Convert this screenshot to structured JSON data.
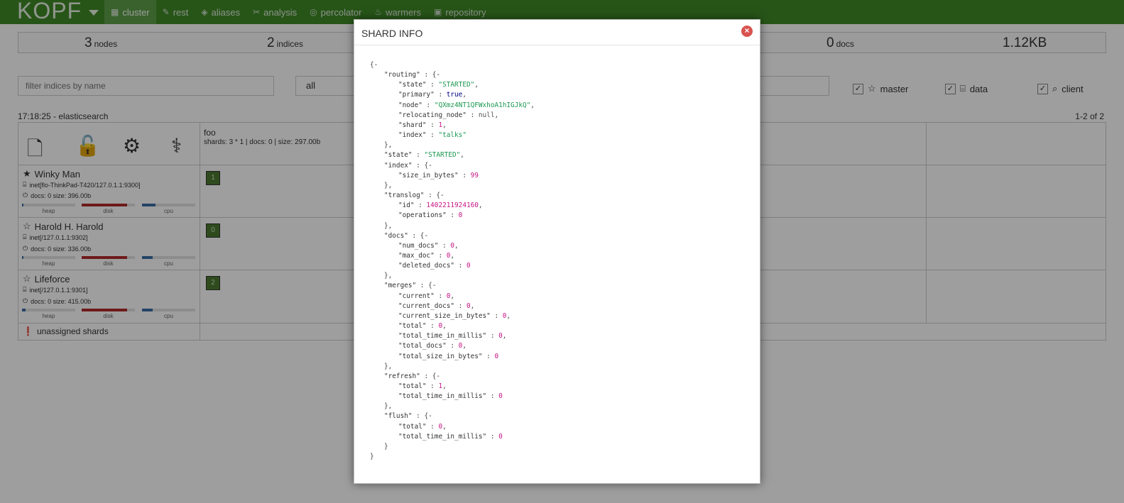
{
  "brand": "KOPF",
  "nav": [
    {
      "label": "cluster",
      "icon": "cluster-icon",
      "active": true
    },
    {
      "label": "rest",
      "icon": "edit-icon"
    },
    {
      "label": "aliases",
      "icon": "tags-icon"
    },
    {
      "label": "analysis",
      "icon": "analysis-icon"
    },
    {
      "label": "percolator",
      "icon": "percolator-icon"
    },
    {
      "label": "warmers",
      "icon": "fire-icon"
    },
    {
      "label": "repository",
      "icon": "briefcase-icon"
    }
  ],
  "stats": {
    "nodes_num": "3",
    "nodes_label": "nodes",
    "indices_num": "2",
    "indices_label": "indices",
    "docs_num": "0",
    "docs_label": "docs",
    "size": "1.12KB"
  },
  "filters": {
    "index_placeholder": "filter indices by name",
    "select_value": "all",
    "master_label": "master",
    "data_label": "data",
    "client_label": "client"
  },
  "cluster_name": "17:18:25 - elasticsearch",
  "pager": "1-2 of 2",
  "index": {
    "name": "foo",
    "info": "shards: 3 * 1 | docs: 0 | size: 297.00b"
  },
  "nodes": [
    {
      "name": "Winky Man",
      "address": "inet[flo-ThinkPad-T420/127.0.1.1:9300]",
      "docs": "docs: 0 size: 396.00b",
      "heap": 0.02,
      "disk": 0.85,
      "cpu": 0.25,
      "shard": "1",
      "master": true
    },
    {
      "name": "Harold H. Harold",
      "address": "inet[/127.0.1.1:9302]",
      "docs": "docs: 0 size: 336.00b",
      "heap": 0.02,
      "disk": 0.85,
      "cpu": 0.2,
      "shard": "0",
      "master": false
    },
    {
      "name": "Lifeforce",
      "address": "inet[/127.0.1.1:9301]",
      "docs": "docs: 0 size: 415.00b",
      "heap": 0.06,
      "disk": 0.85,
      "cpu": 0.2,
      "shard": "2",
      "master": false
    }
  ],
  "bar_labels": {
    "heap": "heap",
    "disk": "disk",
    "cpu": "cpu"
  },
  "unassigned_label": "unassigned shards",
  "modal": {
    "title": "SHARD INFO",
    "lines": [
      [
        [
          0,
          "{"
        ],
        [
          2,
          "-"
        ]
      ],
      [
        [
          1,
          "\"routing\""
        ],
        [
          0,
          " : {"
        ],
        [
          2,
          "-"
        ]
      ],
      [
        [
          1,
          "\"state\""
        ],
        [
          0,
          " : "
        ],
        [
          3,
          "\"STARTED\""
        ],
        [
          0,
          ","
        ]
      ],
      [
        [
          1,
          "\"primary\""
        ],
        [
          0,
          " : "
        ],
        [
          5,
          "true"
        ],
        [
          0,
          ","
        ]
      ],
      [
        [
          1,
          "\"node\""
        ],
        [
          0,
          " : "
        ],
        [
          3,
          "\"QXmz4NT1QFWxhoA1hIGJkQ\""
        ],
        [
          0,
          ","
        ]
      ],
      [
        [
          1,
          "\"relocating_node\""
        ],
        [
          0,
          " : "
        ],
        [
          6,
          "null"
        ],
        [
          0,
          ","
        ]
      ],
      [
        [
          1,
          "\"shard\""
        ],
        [
          0,
          " : "
        ],
        [
          4,
          "1"
        ],
        [
          0,
          ","
        ]
      ],
      [
        [
          1,
          "\"index\""
        ],
        [
          0,
          " : "
        ],
        [
          3,
          "\"talks\""
        ]
      ],
      [
        [
          0,
          "},"
        ]
      ],
      [
        [
          1,
          "\"state\""
        ],
        [
          0,
          " : "
        ],
        [
          3,
          "\"STARTED\""
        ],
        [
          0,
          ","
        ]
      ],
      [
        [
          1,
          "\"index\""
        ],
        [
          0,
          " : {"
        ],
        [
          2,
          "-"
        ]
      ],
      [
        [
          1,
          "\"size_in_bytes\""
        ],
        [
          0,
          " : "
        ],
        [
          4,
          "99"
        ]
      ],
      [
        [
          0,
          "},"
        ]
      ],
      [
        [
          1,
          "\"translog\""
        ],
        [
          0,
          " : {"
        ],
        [
          2,
          "-"
        ]
      ],
      [
        [
          1,
          "\"id\""
        ],
        [
          0,
          " : "
        ],
        [
          4,
          "1402211924160"
        ],
        [
          0,
          ","
        ]
      ],
      [
        [
          1,
          "\"operations\""
        ],
        [
          0,
          " : "
        ],
        [
          4,
          "0"
        ]
      ],
      [
        [
          0,
          "},"
        ]
      ],
      [
        [
          1,
          "\"docs\""
        ],
        [
          0,
          " : {"
        ],
        [
          2,
          "-"
        ]
      ],
      [
        [
          1,
          "\"num_docs\""
        ],
        [
          0,
          " : "
        ],
        [
          4,
          "0"
        ],
        [
          0,
          ","
        ]
      ],
      [
        [
          1,
          "\"max_doc\""
        ],
        [
          0,
          " : "
        ],
        [
          4,
          "0"
        ],
        [
          0,
          ","
        ]
      ],
      [
        [
          1,
          "\"deleted_docs\""
        ],
        [
          0,
          " : "
        ],
        [
          4,
          "0"
        ]
      ],
      [
        [
          0,
          "},"
        ]
      ],
      [
        [
          1,
          "\"merges\""
        ],
        [
          0,
          " : {"
        ],
        [
          2,
          "-"
        ]
      ],
      [
        [
          1,
          "\"current\""
        ],
        [
          0,
          " : "
        ],
        [
          4,
          "0"
        ],
        [
          0,
          ","
        ]
      ],
      [
        [
          1,
          "\"current_docs\""
        ],
        [
          0,
          " : "
        ],
        [
          4,
          "0"
        ],
        [
          0,
          ","
        ]
      ],
      [
        [
          1,
          "\"current_size_in_bytes\""
        ],
        [
          0,
          " : "
        ],
        [
          4,
          "0"
        ],
        [
          0,
          ","
        ]
      ],
      [
        [
          1,
          "\"total\""
        ],
        [
          0,
          " : "
        ],
        [
          4,
          "0"
        ],
        [
          0,
          ","
        ]
      ],
      [
        [
          1,
          "\"total_time_in_millis\""
        ],
        [
          0,
          " : "
        ],
        [
          4,
          "0"
        ],
        [
          0,
          ","
        ]
      ],
      [
        [
          1,
          "\"total_docs\""
        ],
        [
          0,
          " : "
        ],
        [
          4,
          "0"
        ],
        [
          0,
          ","
        ]
      ],
      [
        [
          1,
          "\"total_size_in_bytes\""
        ],
        [
          0,
          " : "
        ],
        [
          4,
          "0"
        ]
      ],
      [
        [
          0,
          "},"
        ]
      ],
      [
        [
          1,
          "\"refresh\""
        ],
        [
          0,
          " : {"
        ],
        [
          2,
          "-"
        ]
      ],
      [
        [
          1,
          "\"total\""
        ],
        [
          0,
          " : "
        ],
        [
          4,
          "1"
        ],
        [
          0,
          ","
        ]
      ],
      [
        [
          1,
          "\"total_time_in_millis\""
        ],
        [
          0,
          " : "
        ],
        [
          4,
          "0"
        ]
      ],
      [
        [
          0,
          "},"
        ]
      ],
      [
        [
          1,
          "\"flush\""
        ],
        [
          0,
          " : {"
        ],
        [
          2,
          "-"
        ]
      ],
      [
        [
          1,
          "\"total\""
        ],
        [
          0,
          " : "
        ],
        [
          4,
          "0"
        ],
        [
          0,
          ","
        ]
      ],
      [
        [
          1,
          "\"total_time_in_millis\""
        ],
        [
          0,
          " : "
        ],
        [
          4,
          "0"
        ]
      ],
      [
        [
          0,
          "}"
        ]
      ],
      [
        [
          0,
          "}"
        ]
      ]
    ]
  },
  "colors": {
    "navbar": "#3f8a28",
    "shard": "#4c7a2f",
    "disk": "#b22b2b",
    "heap": "#3a6ea5",
    "cpu": "#3a6ea5",
    "json_string": "#1a9850",
    "json_number": "#c71585",
    "json_bool": "#00008b"
  }
}
